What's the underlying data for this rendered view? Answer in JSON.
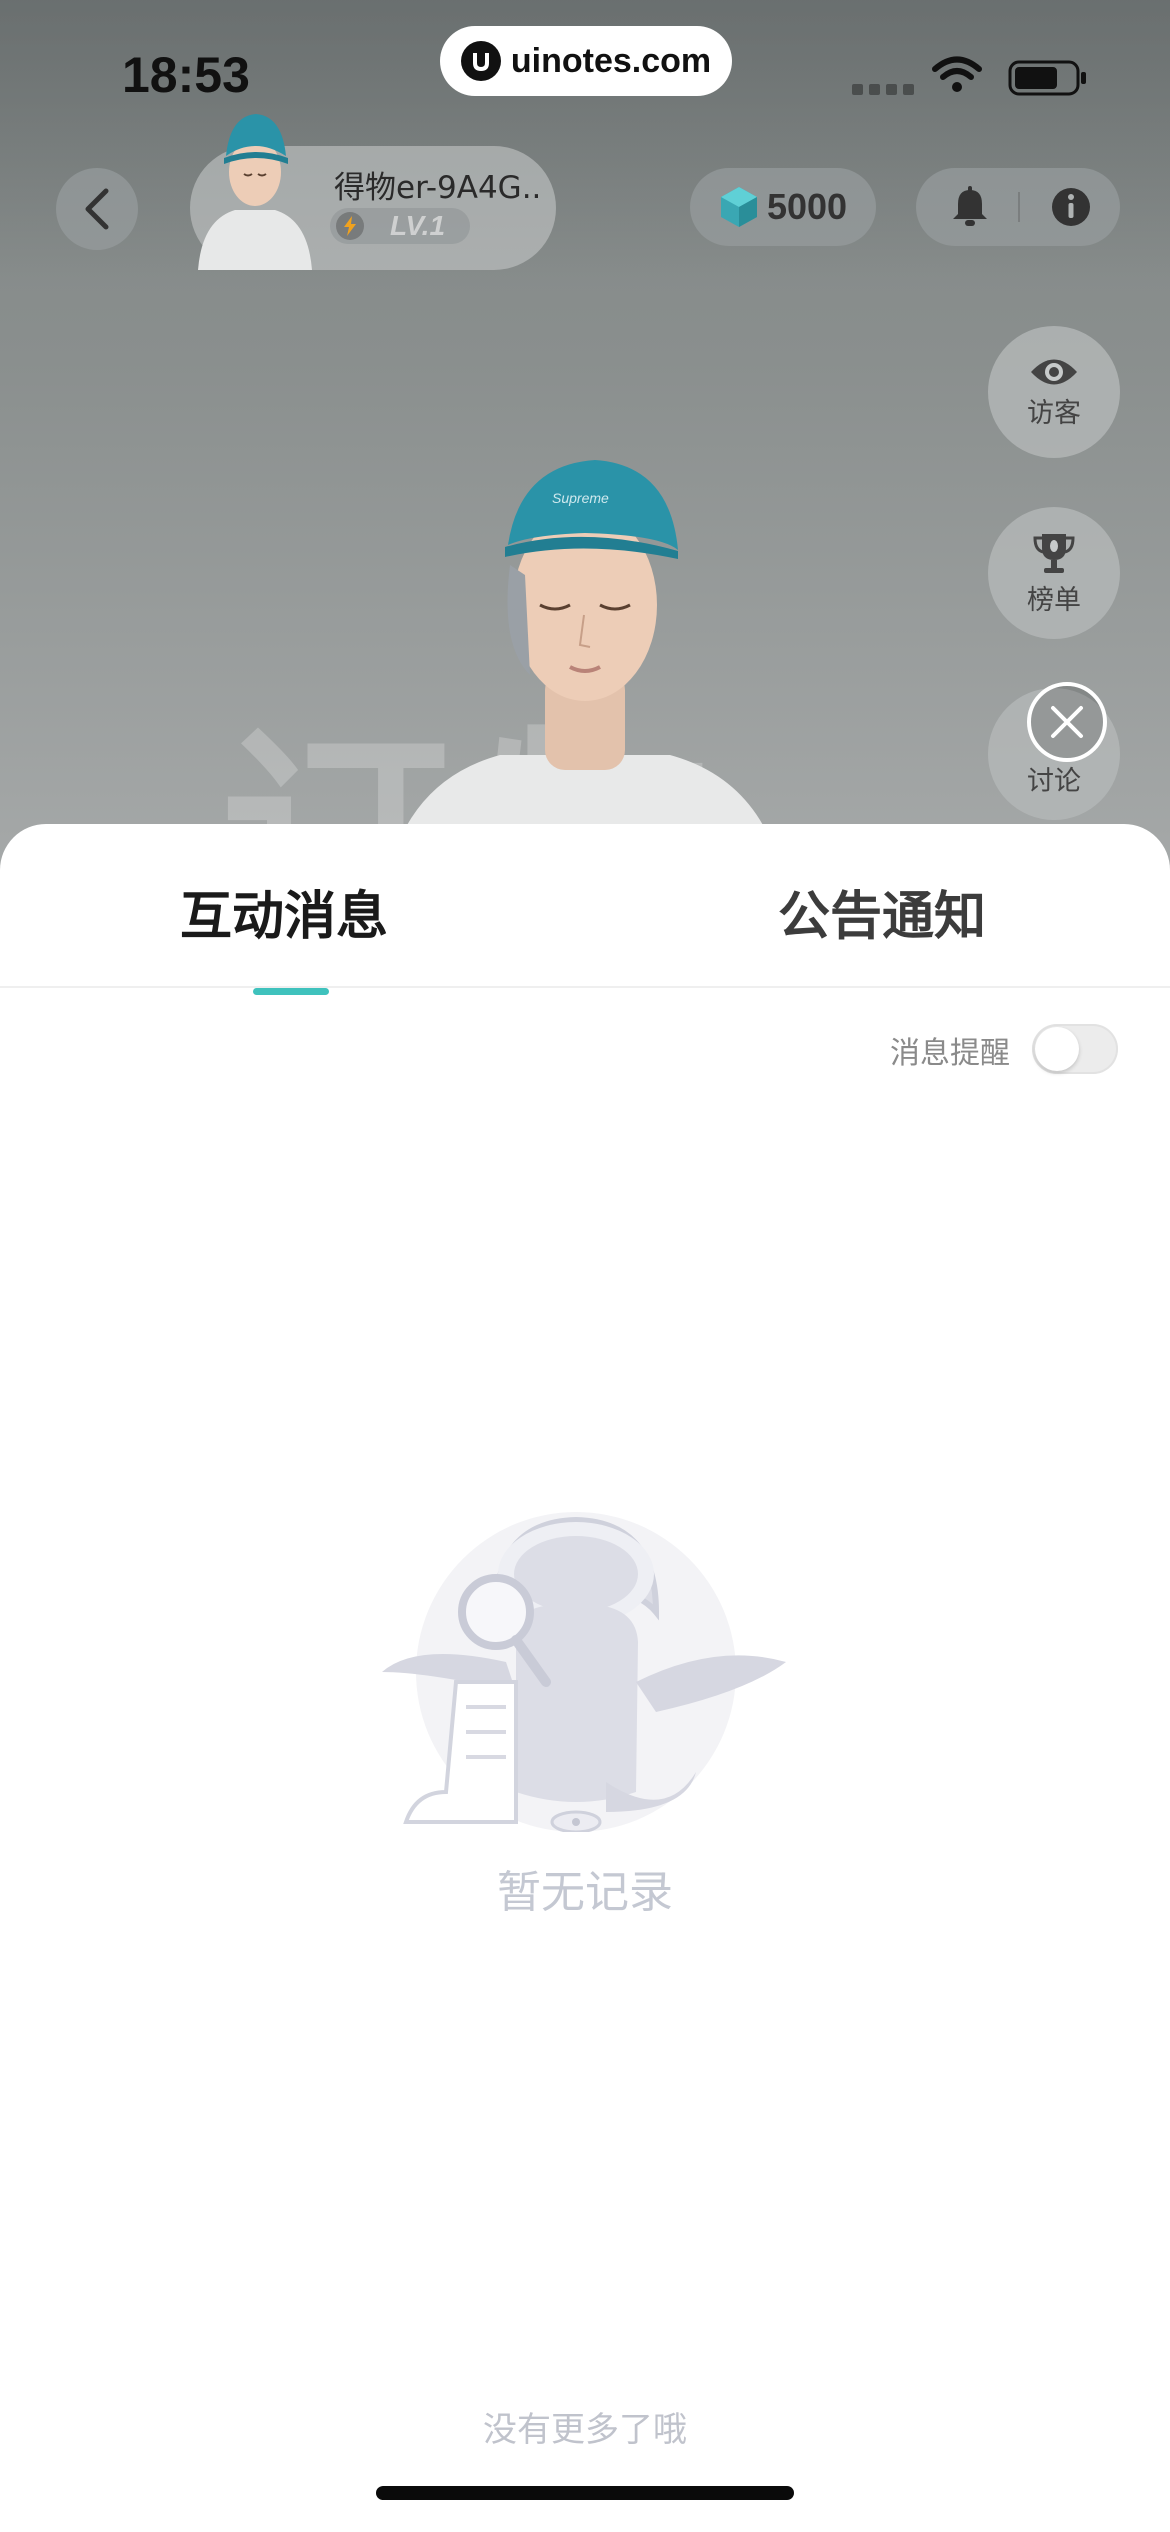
{
  "status_bar": {
    "time": "18:53",
    "url": "uinotes.com"
  },
  "profile": {
    "name": "得物er-9A4G..",
    "level": "LV.1"
  },
  "coins": {
    "amount": "5000"
  },
  "side_buttons": {
    "visitors": "访客",
    "ranking": "榜单",
    "discussion": "讨论"
  },
  "scene": {
    "watermark": "订物"
  },
  "sheet": {
    "tabs": [
      {
        "label": "互动消息",
        "active": true
      },
      {
        "label": "公告通知",
        "active": false
      }
    ],
    "notification_toggle": {
      "label": "消息提醒",
      "on": false
    },
    "empty_text": "暂无记录",
    "no_more_text": "没有更多了哦"
  },
  "colors": {
    "accent": "#3fc2bd",
    "avatar_cap": "#2a93a8"
  }
}
